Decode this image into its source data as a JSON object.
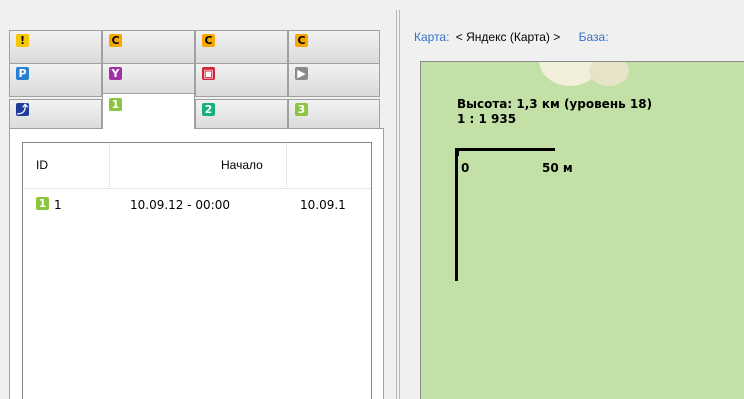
{
  "tabs": {
    "row1": [
      {
        "icon": "warning-icon",
        "glyph": "!",
        "bg": "#f4c700",
        "fg": "#000"
      },
      {
        "icon": "category-c-icon",
        "glyph": "C",
        "bg": "#f4a800",
        "fg": "#000"
      },
      {
        "icon": "category-c-icon",
        "glyph": "C",
        "bg": "#f4a800",
        "fg": "#000"
      },
      {
        "icon": "category-c-icon",
        "glyph": "C",
        "bg": "#f4a800",
        "fg": "#000"
      }
    ],
    "row2": [
      {
        "icon": "parking-icon",
        "glyph": "P",
        "bg": "#2a7fd5",
        "fg": "#fff"
      },
      {
        "icon": "antenna-icon",
        "glyph": "Y",
        "bg": "#a02fa8",
        "fg": "#fff"
      },
      {
        "icon": "camera-icon",
        "glyph": "▣",
        "bg": "#d2233a",
        "fg": "#fff"
      },
      {
        "icon": "no-camera-icon",
        "glyph": "▶",
        "bg": "#8a8a8a",
        "fg": "#fff"
      }
    ],
    "row3": [
      {
        "icon": "route-icon",
        "glyph": "⤴",
        "bg": "#1f3c9c",
        "fg": "#fff"
      },
      {
        "icon": "number-1-icon",
        "glyph": "1",
        "bg": "#8bc53f",
        "fg": "#fff",
        "active": true
      },
      {
        "icon": "number-2-icon",
        "glyph": "2",
        "bg": "#19b07f",
        "fg": "#fff"
      },
      {
        "icon": "number-3-icon",
        "glyph": "3",
        "bg": "#8bc53f",
        "fg": "#fff"
      }
    ]
  },
  "list": {
    "columns": [
      "ID",
      "Начало"
    ],
    "rows": [
      {
        "icon": "number-1-icon",
        "glyph": "1",
        "bg": "#8bc53f",
        "id": "1",
        "start": "10.09.12 - 00:00",
        "end": "10.09.1"
      }
    ]
  },
  "toolbar": {
    "map_label": "Карта:",
    "map_value": "< Яндекс (Карта) >",
    "base_label": "База:"
  },
  "map": {
    "height_text": "Высота: 1,3 км (уровень 18)",
    "scale_text": "1 : 1 935",
    "scale_zero": "0",
    "scale_distance": "50 м"
  }
}
